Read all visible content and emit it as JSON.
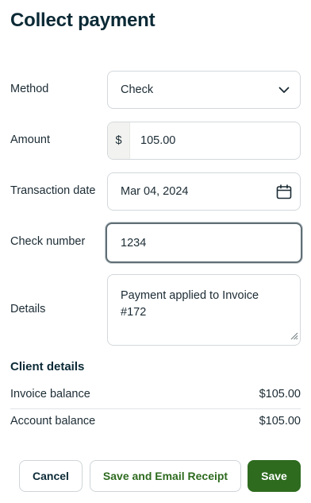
{
  "page": {
    "title": "Collect payment"
  },
  "form": {
    "method": {
      "label": "Method",
      "value": "Check",
      "icon": "chevron-down-icon"
    },
    "amount": {
      "label": "Amount",
      "currency_symbol": "$",
      "value": "105.00"
    },
    "transaction_date": {
      "label": "Transaction date",
      "value": "Mar 04, 2024",
      "icon": "calendar-icon"
    },
    "check_number": {
      "label": "Check number",
      "value": "1234"
    },
    "details": {
      "label": "Details",
      "value": "Payment applied to Invoice\n#172"
    }
  },
  "client_details": {
    "title": "Client details",
    "rows": [
      {
        "label": "Invoice balance",
        "value": "$105.00"
      },
      {
        "label": "Account balance",
        "value": "$105.00"
      }
    ]
  },
  "actions": {
    "cancel_label": "Cancel",
    "save_email_label": "Save and Email Receipt",
    "save_label": "Save"
  },
  "colors": {
    "primary_green": "#2e6b1f",
    "heading": "#0b2a36",
    "border": "#d3d8db"
  }
}
